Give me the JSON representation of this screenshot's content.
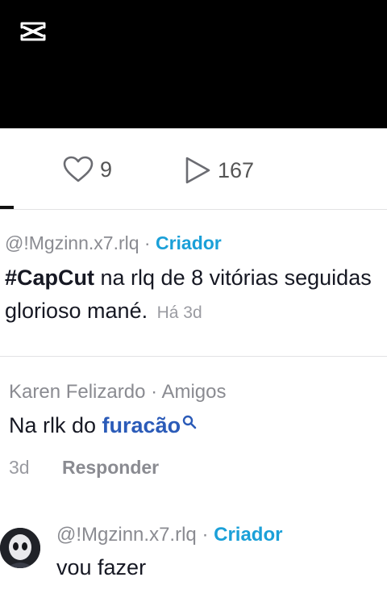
{
  "stats": {
    "likes": "9",
    "views": "167"
  },
  "comments": [
    {
      "user": "@!Mgzinn.x7.rlq",
      "separator": "·",
      "role": "Criador",
      "hashtag": "#CapCut",
      "text_line1": " na rlq de 8 vitórias seguidas",
      "text_line2": "glorioso mané.",
      "time": "Há 3d"
    },
    {
      "user": "Karen Felizardo",
      "separator": "·",
      "role": "Amigos",
      "text": "Na rlk do ",
      "link": "furacão",
      "time": "3d",
      "reply_label": "Responder"
    },
    {
      "user": "@!Mgzinn.x7.rlq",
      "separator": "·",
      "role": "Criador",
      "text": "vou fazer"
    }
  ],
  "icons": {
    "brand": "capcut-logo-icon",
    "like": "heart-icon",
    "views": "play-icon",
    "search": "search-icon"
  },
  "colors": {
    "role": "#1ba0d8",
    "link": "#2b5bb8",
    "muted": "#8a8b91"
  }
}
